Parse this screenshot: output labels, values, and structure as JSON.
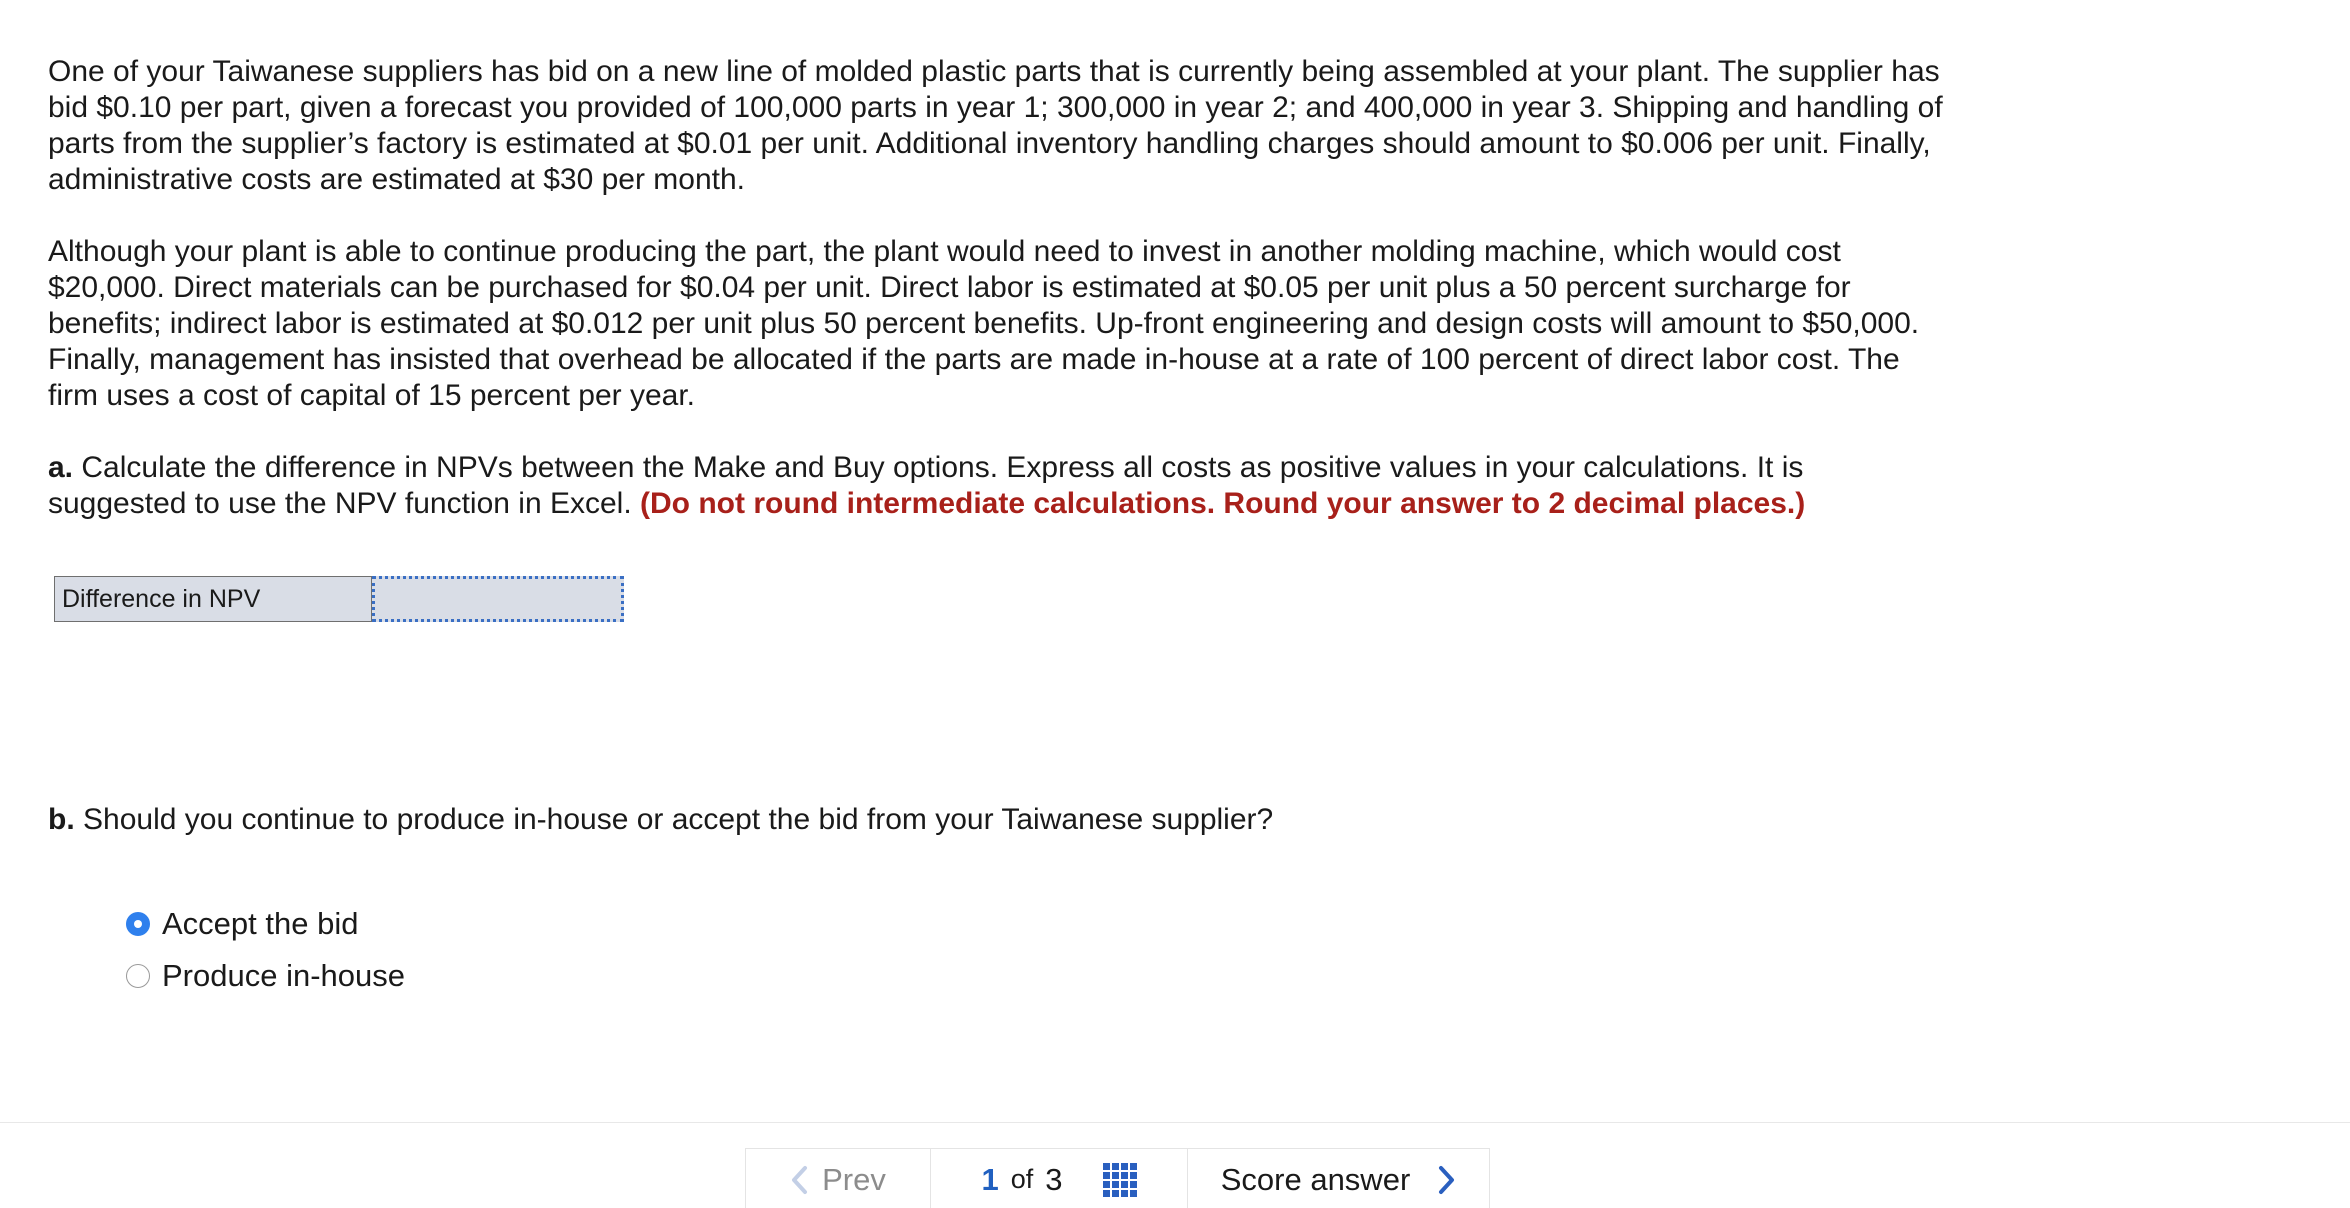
{
  "question": {
    "para1": "One of your Taiwanese suppliers has bid on a new line of molded plastic parts that is currently being assembled at your plant. The supplier has bid $0.10 per part, given a forecast you provided of 100,000 parts in year 1; 300,000 in year 2; and 400,000 in year 3. Shipping and handling of parts from the supplier’s factory is estimated at $0.01 per unit. Additional inventory handling charges should amount to $0.006 per unit. Finally, administrative costs are estimated at $30 per month.",
    "para2": "Although your plant is able to continue producing the part, the plant would need to invest in another molding machine, which would cost $20,000. Direct materials can be purchased for $0.04 per unit. Direct labor is estimated at $0.05 per unit plus a 50 percent surcharge for benefits; indirect labor is estimated at $0.012 per unit plus 50 percent benefits. Up-front engineering and design costs will amount to $50,000. Finally, management has insisted that overhead be allocated if the parts are made in-house at a rate of 100 percent of direct labor cost. The firm uses a cost of capital of 15 percent per year.",
    "part_a_prefix": "a.",
    "part_a_text": "Calculate the difference in NPVs between the Make and Buy options. Express all costs as positive values in your calculations. It is suggested to use the NPV function in Excel.",
    "part_a_instruction": "(Do not round intermediate calculations. Round your answer to 2 decimal places.)",
    "npv_label": "Difference in NPV",
    "npv_value": "",
    "part_b_prefix": "b.",
    "part_b_text": "Should you continue to produce in-house or accept the bid from your Taiwanese supplier?",
    "options": [
      {
        "label": "Accept the bid",
        "selected": true
      },
      {
        "label": "Produce in-house",
        "selected": false
      }
    ]
  },
  "footer": {
    "prev_label": "Prev",
    "page_current": "1",
    "page_of": "of",
    "page_total": "3",
    "score_label": "Score answer"
  },
  "colors": {
    "instruction_red": "#a8201a",
    "radio_blue": "#2f80ed",
    "page_blue": "#2060c0"
  },
  "icons": {
    "prev": "chevron-left-icon",
    "grid": "grid-icon",
    "next": "chevron-right-icon"
  }
}
